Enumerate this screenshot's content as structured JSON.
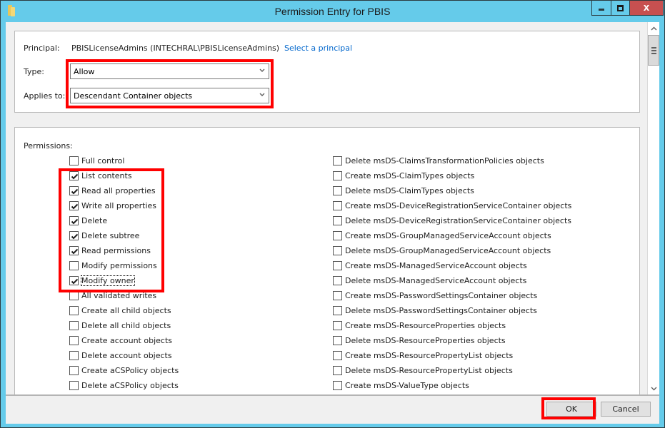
{
  "window": {
    "title": "Permission Entry for PBIS",
    "icon": "folder-icon",
    "caption_buttons": {
      "minimize": "minimize-icon",
      "maximize": "maximize-icon",
      "close_label": "X"
    }
  },
  "principal": {
    "label": "Principal:",
    "value": "PBISLicenseAdmins (INTECHRAL\\PBISLicenseAdmins)",
    "link_label": "Select a principal"
  },
  "type": {
    "label": "Type:",
    "selected": "Allow"
  },
  "applies_to": {
    "label": "Applies to:",
    "selected": "Descendant Container objects"
  },
  "permissions": {
    "label": "Permissions:",
    "left_column": [
      {
        "label": "Full control",
        "checked": false
      },
      {
        "label": "List contents",
        "checked": true
      },
      {
        "label": "Read all properties",
        "checked": true
      },
      {
        "label": "Write all properties",
        "checked": true
      },
      {
        "label": "Delete",
        "checked": true
      },
      {
        "label": "Delete subtree",
        "checked": true
      },
      {
        "label": "Read permissions",
        "checked": true
      },
      {
        "label": "Modify permissions",
        "checked": false
      },
      {
        "label": "Modify owner",
        "checked": true,
        "focused": true
      },
      {
        "label": "All validated writes",
        "checked": false
      },
      {
        "label": "Create all child objects",
        "checked": false
      },
      {
        "label": "Delete all child objects",
        "checked": false
      },
      {
        "label": "Create account objects",
        "checked": false
      },
      {
        "label": "Delete account objects",
        "checked": false
      },
      {
        "label": "Create aCSPolicy objects",
        "checked": false
      },
      {
        "label": "Delete aCSPolicy objects",
        "checked": false
      }
    ],
    "right_column": [
      {
        "label": "Delete msDS-ClaimsTransformationPolicies objects",
        "checked": false
      },
      {
        "label": "Create msDS-ClaimTypes objects",
        "checked": false
      },
      {
        "label": "Delete msDS-ClaimTypes objects",
        "checked": false
      },
      {
        "label": "Create msDS-DeviceRegistrationServiceContainer objects",
        "checked": false
      },
      {
        "label": "Delete msDS-DeviceRegistrationServiceContainer objects",
        "checked": false
      },
      {
        "label": "Create msDS-GroupManagedServiceAccount objects",
        "checked": false
      },
      {
        "label": "Delete msDS-GroupManagedServiceAccount objects",
        "checked": false
      },
      {
        "label": "Create msDS-ManagedServiceAccount objects",
        "checked": false
      },
      {
        "label": "Delete msDS-ManagedServiceAccount objects",
        "checked": false
      },
      {
        "label": "Create msDS-PasswordSettingsContainer objects",
        "checked": false
      },
      {
        "label": "Delete msDS-PasswordSettingsContainer objects",
        "checked": false
      },
      {
        "label": "Create msDS-ResourceProperties objects",
        "checked": false
      },
      {
        "label": "Delete msDS-ResourceProperties objects",
        "checked": false
      },
      {
        "label": "Create msDS-ResourcePropertyList objects",
        "checked": false
      },
      {
        "label": "Delete msDS-ResourcePropertyList objects",
        "checked": false
      },
      {
        "label": "Create msDS-ValueType objects",
        "checked": false
      }
    ]
  },
  "buttons": {
    "ok": "OK",
    "cancel": "Cancel"
  },
  "colors": {
    "titlebar": "#65cbea",
    "close_button": "#c75050",
    "highlight": "#ff0000",
    "link": "#0066cc"
  }
}
